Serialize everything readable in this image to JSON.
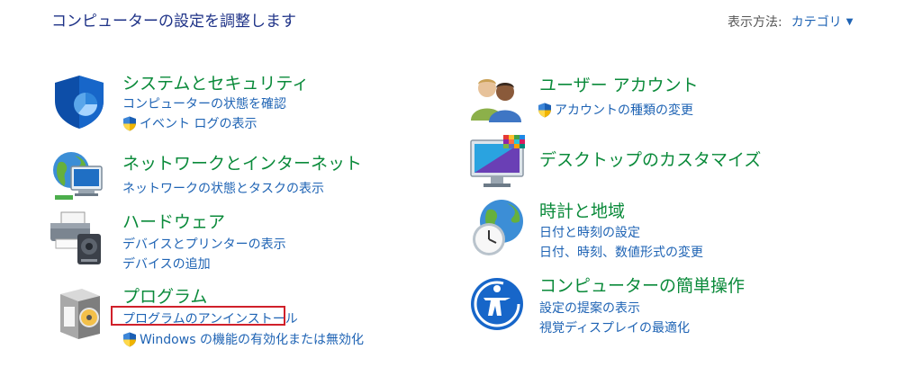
{
  "header": {
    "title": "コンピューターの設定を調整します",
    "view_by_label": "表示方法:",
    "view_by_value": "カテゴリ"
  },
  "categories": {
    "system_security": {
      "title": "システムとセキュリティ",
      "links": [
        "コンピューターの状態を確認",
        "イベント ログの表示"
      ]
    },
    "network": {
      "title": "ネットワークとインターネット",
      "links": [
        "ネットワークの状態とタスクの表示"
      ]
    },
    "hardware": {
      "title": "ハードウェア",
      "links": [
        "デバイスとプリンターの表示",
        "デバイスの追加"
      ]
    },
    "programs": {
      "title": "プログラム",
      "links": [
        "プログラムのアンインストール",
        "Windows の機能の有効化または無効化"
      ]
    },
    "user_accounts": {
      "title": "ユーザー アカウント",
      "links": [
        "アカウントの種類の変更"
      ]
    },
    "appearance": {
      "title": "デスクトップのカスタマイズ",
      "links": []
    },
    "clock_region": {
      "title": "時計と地域",
      "links": [
        "日付と時刻の設定",
        "日付、時刻、数値形式の変更"
      ]
    },
    "ease_of_access": {
      "title": "コンピューターの簡単操作",
      "links": [
        "設定の提案の表示",
        "視覚ディスプレイの最適化"
      ]
    }
  },
  "colors": {
    "title_green": "#0a8a3a",
    "link_blue": "#1e63b4",
    "header_blue": "#1e3287",
    "highlight_red": "#d0202a"
  }
}
